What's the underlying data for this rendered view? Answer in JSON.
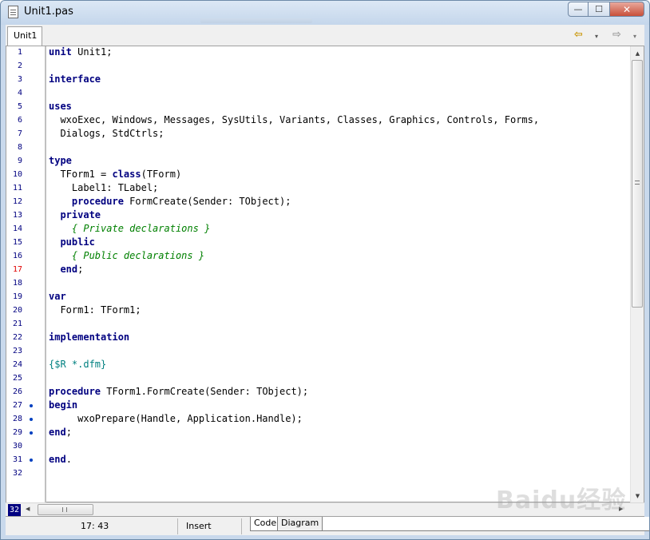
{
  "window": {
    "title": "Unit1.pas",
    "min_icon": "minimize-icon",
    "max_icon": "maximize-icon",
    "close_icon": "close-icon"
  },
  "tabs": [
    {
      "label": "Unit1"
    }
  ],
  "nav": {
    "back_icon": "back-arrow-icon",
    "forward_icon": "forward-arrow-icon",
    "dropdown_glyph": "▾"
  },
  "editor": {
    "error_line": 17,
    "breakpoint_lines": [
      27,
      28,
      29,
      31
    ],
    "lines": [
      [
        [
          "kw",
          "unit"
        ],
        [
          "t",
          " Unit1;"
        ]
      ],
      [],
      [
        [
          "kw",
          "interface"
        ]
      ],
      [],
      [
        [
          "kw",
          "uses"
        ]
      ],
      [
        [
          "t",
          "  wxoExec, Windows, Messages, SysUtils, Variants, Classes, Graphics, Controls, Forms,"
        ]
      ],
      [
        [
          "t",
          "  Dialogs, StdCtrls;"
        ]
      ],
      [],
      [
        [
          "kw",
          "type"
        ]
      ],
      [
        [
          "t",
          "  TForm1 = "
        ],
        [
          "kw",
          "class"
        ],
        [
          "t",
          "(TForm)"
        ]
      ],
      [
        [
          "t",
          "    Label1: TLabel;"
        ]
      ],
      [
        [
          "t",
          "    "
        ],
        [
          "kw",
          "procedure"
        ],
        [
          "t",
          " FormCreate(Sender: TObject);"
        ]
      ],
      [
        [
          "t",
          "  "
        ],
        [
          "kw",
          "private"
        ]
      ],
      [
        [
          "t",
          "    "
        ],
        [
          "cm",
          "{ Private declarations }"
        ]
      ],
      [
        [
          "t",
          "  "
        ],
        [
          "kw",
          "public"
        ]
      ],
      [
        [
          "t",
          "    "
        ],
        [
          "cm",
          "{ Public declarations }"
        ]
      ],
      [
        [
          "t",
          "  "
        ],
        [
          "kw",
          "end"
        ],
        [
          "t",
          ";"
        ]
      ],
      [],
      [
        [
          "kw",
          "var"
        ]
      ],
      [
        [
          "t",
          "  Form1: TForm1;"
        ]
      ],
      [],
      [
        [
          "kw",
          "implementation"
        ]
      ],
      [],
      [
        [
          "dr",
          "{$R *.dfm}"
        ]
      ],
      [],
      [
        [
          "kw",
          "procedure"
        ],
        [
          "t",
          " TForm1.FormCreate(Sender: TObject);"
        ]
      ],
      [
        [
          "kw",
          "begin"
        ]
      ],
      [
        [
          "t",
          "     wxoPrepare(Handle, Application.Handle);"
        ]
      ],
      [
        [
          "kw",
          "end"
        ],
        [
          "t",
          ";"
        ]
      ],
      [],
      [
        [
          "kw",
          "end"
        ],
        [
          "t",
          "."
        ]
      ],
      []
    ]
  },
  "hscroll": {
    "line_count": "32",
    "grip": "III"
  },
  "vscroll": {
    "grip": "≡"
  },
  "status": {
    "position": "17: 43",
    "mode": "Insert"
  },
  "bottom_tabs": {
    "code": "Code",
    "diagram": "Diagram"
  },
  "watermark": "Baidu经验",
  "colors": {
    "keyword": "#000080",
    "comment": "#008000",
    "directive": "#008080",
    "line_numbers": "#000080",
    "error_line_number": "#e00000"
  }
}
